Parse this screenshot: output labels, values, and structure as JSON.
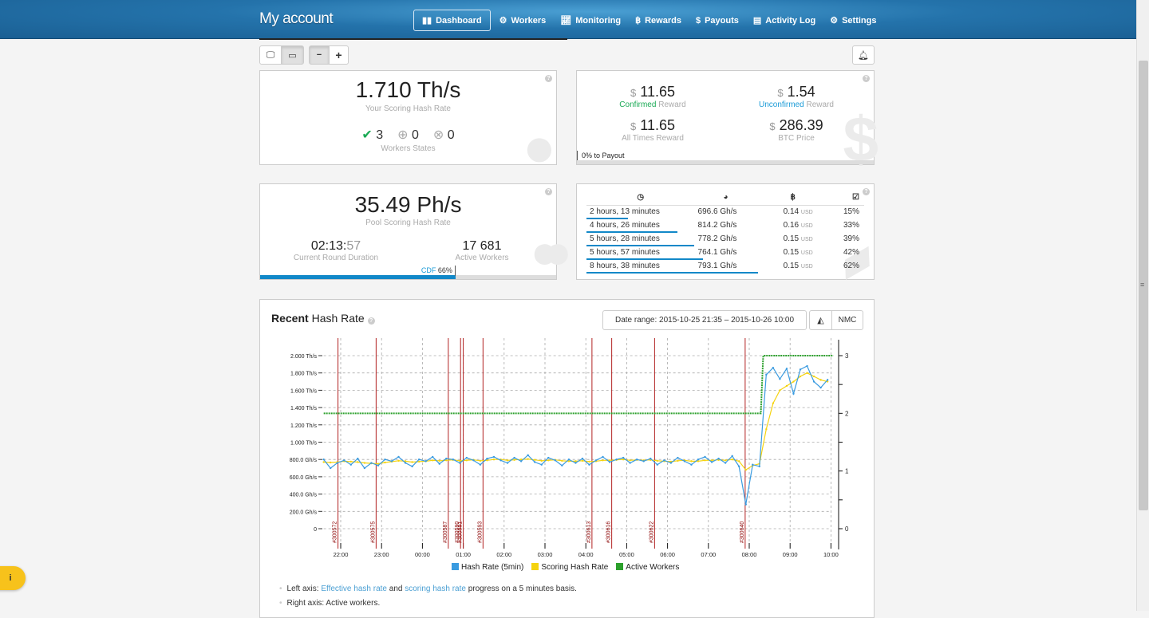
{
  "header": {
    "title": "My account",
    "nav": [
      {
        "label": "Dashboard",
        "icon": "dashboard-icon",
        "active": true
      },
      {
        "label": "Workers",
        "icon": "gears-icon"
      },
      {
        "label": "Monitoring",
        "icon": "line-chart-icon"
      },
      {
        "label": "Rewards",
        "icon": "bitcoin-icon"
      },
      {
        "label": "Payouts",
        "icon": "dollar-icon"
      },
      {
        "label": "Activity Log",
        "icon": "book-icon"
      },
      {
        "label": "Settings",
        "icon": "gear-icon"
      }
    ]
  },
  "toolbar": {
    "minus": "−",
    "plus": "+"
  },
  "user_hash": {
    "value": "1.710 Th/s",
    "label": "Your Scoring Hash Rate",
    "states": {
      "ok": "3",
      "down": "0",
      "error": "0"
    },
    "states_label": "Workers States"
  },
  "rewards": {
    "confirmed": {
      "value": "11.65",
      "label_hl": "Confirmed",
      "label": " Reward"
    },
    "unconfirmed": {
      "value": "1.54",
      "label_hl": "Unconfirmed",
      "label": " Reward"
    },
    "all_times": {
      "value": "11.65",
      "label": "All Times Reward"
    },
    "btc_price": {
      "value": "286.39",
      "label": "BTC Price"
    },
    "currency": "$",
    "payout": "0% to Payout",
    "payout_progress": 0,
    "confirmed_color": "#1aaa55",
    "unconfirmed_color": "#1b9bd7"
  },
  "pool": {
    "value": "35.49 Ph/s",
    "label": "Pool Scoring Hash Rate",
    "duration_main": "02:13:",
    "duration_sec": "57",
    "duration_label": "Current Round Duration",
    "workers": "17 681",
    "workers_label": "Active Workers",
    "cdf_label": "CDF",
    "cdf_value": "66%",
    "cdf_progress": 66
  },
  "rounds": {
    "rows": [
      {
        "duration": "2 hours, 13 minutes",
        "rate": "696.6 Gh/s",
        "reward": "0.14",
        "unit": "USD",
        "pct": "15%",
        "progress": 15
      },
      {
        "duration": "4 hours, 26 minutes",
        "rate": "814.2 Gh/s",
        "reward": "0.16",
        "unit": "USD",
        "pct": "33%",
        "progress": 33
      },
      {
        "duration": "5 hours, 28 minutes",
        "rate": "778.2 Gh/s",
        "reward": "0.15",
        "unit": "USD",
        "pct": "39%",
        "progress": 39
      },
      {
        "duration": "5 hours, 57 minutes",
        "rate": "764.1 Gh/s",
        "reward": "0.15",
        "unit": "USD",
        "pct": "42%",
        "progress": 42
      },
      {
        "duration": "8 hours, 38 minutes",
        "rate": "793.1 Gh/s",
        "reward": "0.15",
        "unit": "USD",
        "pct": "62%",
        "progress": 62
      }
    ]
  },
  "chart_panel": {
    "title_bold": "Recent",
    "title": " Hash Rate",
    "date_range": "Date range: 2015-10-25 21:35 – 2015-10-26 10:00",
    "nmc": "NMC",
    "notes": [
      {
        "pre": "Left axis: ",
        "l1": "Effective hash rate",
        "mid": " and ",
        "l2": "scoring hash rate",
        "post": " progress on a 5 minutes basis."
      },
      {
        "pre": "Right axis: Active workers."
      }
    ]
  },
  "chart_data": {
    "type": "line",
    "x_ticks": [
      "22:00",
      "23:00",
      "00:00",
      "01:00",
      "02:00",
      "03:00",
      "04:00",
      "05:00",
      "06:00",
      "07:00",
      "08:00",
      "09:00",
      "10:00"
    ],
    "y_ticks_left": [
      "0",
      "200.0 Gh/s",
      "400.0 Gh/s",
      "600.0 Gh/s",
      "800.0 Gh/s",
      "1.000 Th/s",
      "1.200 Th/s",
      "1.400 Th/s",
      "1.600 Th/s",
      "1.800 Th/s",
      "2.000 Th/s"
    ],
    "ylim_left_ghs": [
      0,
      2000
    ],
    "y_ticks_right": [
      "0",
      "1",
      "2",
      "3"
    ],
    "ylim_right": [
      0,
      3
    ],
    "xlim": [
      "21:35",
      "10:00"
    ],
    "grid": true,
    "legend_position": "bottom",
    "x": [
      "21:35",
      "21:45",
      "21:55",
      "22:05",
      "22:15",
      "22:25",
      "22:35",
      "22:45",
      "22:55",
      "23:05",
      "23:15",
      "23:25",
      "23:35",
      "23:45",
      "23:55",
      "00:05",
      "00:15",
      "00:25",
      "00:35",
      "00:45",
      "00:55",
      "01:05",
      "01:15",
      "01:25",
      "01:35",
      "01:45",
      "01:55",
      "02:05",
      "02:15",
      "02:25",
      "02:35",
      "02:45",
      "02:55",
      "03:05",
      "03:15",
      "03:25",
      "03:35",
      "03:45",
      "03:55",
      "04:05",
      "04:15",
      "04:25",
      "04:35",
      "04:45",
      "04:55",
      "05:05",
      "05:15",
      "05:25",
      "05:35",
      "05:45",
      "05:55",
      "06:05",
      "06:15",
      "06:25",
      "06:35",
      "06:45",
      "06:55",
      "07:05",
      "07:15",
      "07:25",
      "07:35",
      "07:45",
      "07:55",
      "08:05",
      "08:15",
      "08:25",
      "08:35",
      "08:45",
      "08:55",
      "09:05",
      "09:15",
      "09:25",
      "09:35",
      "09:45",
      "09:55"
    ],
    "series": [
      {
        "name": "Hash Rate (5min)",
        "color": "#3a9be0",
        "unit": "Gh/s",
        "values": [
          800,
          700,
          760,
          790,
          740,
          810,
          700,
          760,
          730,
          800,
          780,
          830,
          760,
          720,
          800,
          780,
          830,
          750,
          810,
          800,
          760,
          820,
          790,
          740,
          810,
          830,
          790,
          760,
          820,
          780,
          850,
          770,
          740,
          820,
          790,
          730,
          800,
          760,
          810,
          740,
          790,
          830,
          770,
          800,
          820,
          760,
          800,
          780,
          810,
          740,
          790,
          760,
          820,
          780,
          740,
          800,
          830,
          770,
          810,
          760,
          840,
          720,
          280,
          740,
          720,
          1780,
          1860,
          1730,
          1850,
          1560,
          1840,
          1880,
          1700,
          1630,
          1720
        ]
      },
      {
        "name": "Scoring Hash Rate",
        "color": "#f5d30f",
        "unit": "Gh/s",
        "values": [
          770,
          765,
          770,
          780,
          775,
          770,
          760,
          755,
          750,
          765,
          775,
          785,
          780,
          770,
          775,
          780,
          790,
          785,
          790,
          795,
          785,
          790,
          795,
          785,
          790,
          800,
          800,
          790,
          795,
          800,
          805,
          795,
          785,
          790,
          795,
          785,
          780,
          780,
          785,
          775,
          780,
          790,
          790,
          795,
          800,
          790,
          795,
          790,
          795,
          785,
          780,
          775,
          785,
          790,
          780,
          780,
          790,
          790,
          795,
          790,
          800,
          780,
          680,
          730,
          750,
          1150,
          1450,
          1600,
          1650,
          1700,
          1760,
          1800,
          1760,
          1720,
          1700
        ]
      },
      {
        "name": "Active Workers",
        "color": "#2ca02c",
        "axis": "right",
        "steps": [
          {
            "time": "21:35",
            "value": 2
          },
          {
            "time": "08:17",
            "value": 3
          },
          {
            "time": "10:00",
            "value": 3
          }
        ]
      }
    ],
    "blocks": [
      {
        "label": "#300572",
        "time": "21:56"
      },
      {
        "label": "#300575",
        "time": "22:52"
      },
      {
        "label": "#300587",
        "time": "00:38"
      },
      {
        "label": "#300590",
        "time": "00:56"
      },
      {
        "label": "#300591",
        "time": "01:00"
      },
      {
        "label": "#300593",
        "time": "01:29"
      },
      {
        "label": "#300613",
        "time": "04:09"
      },
      {
        "label": "#300616",
        "time": "04:38"
      },
      {
        "label": "#300622",
        "time": "05:41"
      },
      {
        "label": "#300640",
        "time": "07:54"
      }
    ],
    "block_color": "#b22222"
  },
  "info_button": "i"
}
